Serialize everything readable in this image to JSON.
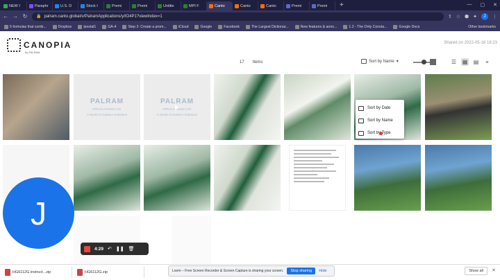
{
  "browser": {
    "tabs": [
      {
        "label": "NEW I",
        "color": "#3ca55c"
      },
      {
        "label": "Paraphr",
        "color": "#7c4dff"
      },
      {
        "label": "U.S. D",
        "color": "#1e88e5"
      },
      {
        "label": "Stock I",
        "color": "#1e88e5"
      },
      {
        "label": "Premi",
        "color": "#2e7d32"
      },
      {
        "label": "Premi",
        "color": "#2e7d32"
      },
      {
        "label": "Untitle",
        "color": "#2e7d32"
      },
      {
        "label": "MPI F",
        "color": "#2e7d32"
      },
      {
        "label": "Canto",
        "color": "#ff6d00"
      },
      {
        "label": "Canto",
        "color": "#ff6d00"
      },
      {
        "label": "Canto",
        "color": "#ff6d00"
      },
      {
        "label": "Premi",
        "color": "#5c6bc0"
      },
      {
        "label": "Premi",
        "color": "#5c6bc0"
      }
    ],
    "active_tab_index": 8,
    "new_tab": "+",
    "url": "palram.canto.global/v/PalramApplications/y/IO4P1?viewIndex=1",
    "profile_initial": "J",
    "bookmarks": [
      "5 formulas that comb...",
      "Dropbox",
      "ipostal1",
      "GA-4",
      "Step 2: Create a prom...",
      "iCloud",
      "Google",
      "Facebook",
      "The Largest Dictionar...",
      "New features & anno...",
      "1.2 - The Only Consta...",
      "Google Docs"
    ],
    "bookmarks_other": "Other bookmarks"
  },
  "page": {
    "logo_name": "CANOPIA",
    "logo_sub": "by PALRAM",
    "shared_on": "Shared on 2022-05-16 18:23",
    "item_count": "17",
    "items_label": "Items",
    "sort_label": "Sort by Name",
    "sort_menu": [
      "Sort by Date",
      "Sort by Name",
      "Sort by Type"
    ],
    "palram_logo": "PALRAM",
    "palram_sub": "APPLICATIONS LTD.",
    "palram_tagline": "A World of Outdoor Solutions"
  },
  "recording": {
    "time": "4:29",
    "avatar_initial": "J"
  },
  "shelf": {
    "downloads": [
      "HG6112G instruct...zip",
      "HG6112G.zip"
    ],
    "share_text": "Loom – Free Screen Recorder & Screen Capture is sharing your screen.",
    "stop_sharing": "Stop sharing",
    "hide": "Hide",
    "show_all": "Show all"
  }
}
